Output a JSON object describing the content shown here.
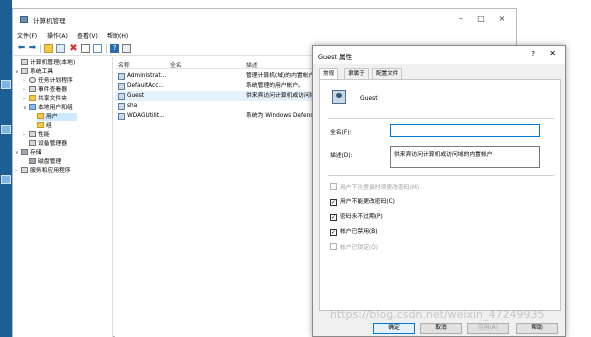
{
  "mmc": {
    "title": "计算机管理",
    "menu": [
      "文件(F)",
      "操作(A)",
      "查看(V)",
      "帮助(H)"
    ],
    "tree": [
      {
        "label": "计算机管理(本地)",
        "exp": "",
        "icon": "computer-icon"
      },
      {
        "label": "系统工具",
        "exp": "∨",
        "icon": "tools-icon"
      },
      {
        "label": "任务计划程序",
        "exp": "›",
        "icon": "clock-icon"
      },
      {
        "label": "事件查看器",
        "exp": "›",
        "icon": "event-viewer-icon"
      },
      {
        "label": "共享文件夹",
        "exp": "›",
        "icon": "shared-folder-icon"
      },
      {
        "label": "本地用户和组",
        "exp": "∨",
        "icon": "users-icon"
      },
      {
        "label": "用户",
        "exp": "",
        "icon": "folder-icon"
      },
      {
        "label": "组",
        "exp": "",
        "icon": "folder-icon"
      },
      {
        "label": "性能",
        "exp": "›",
        "icon": "performance-icon"
      },
      {
        "label": "设备管理器",
        "exp": "",
        "icon": "device-manager-icon"
      },
      {
        "label": "存储",
        "exp": "∨",
        "icon": "storage-icon"
      },
      {
        "label": "磁盘管理",
        "exp": "",
        "icon": "disk-icon"
      },
      {
        "label": "服务和应用程序",
        "exp": "›",
        "icon": "services-icon"
      }
    ],
    "list_headers": {
      "name": "名称",
      "fullname": "全名",
      "desc": "描述"
    },
    "users": [
      {
        "name": "Administrat...",
        "desc": "管理计算机(域)的内置帐户"
      },
      {
        "name": "DefaultAcc...",
        "desc": "系统管理的用户帐户。"
      },
      {
        "name": "Guest",
        "desc": "供来宾访问计算机或访问域"
      },
      {
        "name": "sha",
        "desc": ""
      },
      {
        "name": "WDAGUtilit...",
        "desc": "系统为 Windows Defender"
      }
    ]
  },
  "dialog": {
    "title": "Guest 属性",
    "help": "?",
    "tabs": [
      "常规",
      "隶属于",
      "配置文件"
    ],
    "username": "Guest",
    "fullname_label": "全名(F):",
    "fullname_value": "",
    "desc_label": "描述(D):",
    "desc_value": "供来宾访问计算机或访问域的内置帐户",
    "checks": [
      {
        "label": "用户下次登录时须更改密码(M)",
        "checked": false,
        "disabled": true
      },
      {
        "label": "用户不能更改密码(C)",
        "checked": true,
        "disabled": false
      },
      {
        "label": "密码永不过期(P)",
        "checked": true,
        "disabled": false
      },
      {
        "label": "帐户已禁用(B)",
        "checked": true,
        "disabled": false
      },
      {
        "label": "帐户已锁定(O)",
        "checked": false,
        "disabled": true
      }
    ],
    "buttons": {
      "ok": "确定",
      "cancel": "取消",
      "apply": "应用(A)",
      "help": "帮助"
    }
  },
  "watermark": "https://blog.csdn.net/weixin_47249935"
}
